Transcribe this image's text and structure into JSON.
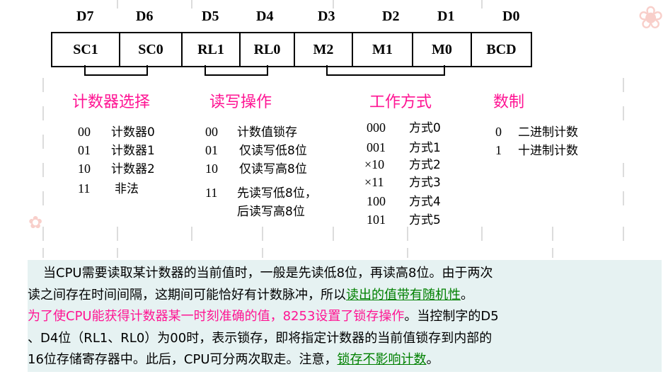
{
  "bits": [
    "D7",
    "D6",
    "D5",
    "D4",
    "D3",
    "D2",
    "D1",
    "D0"
  ],
  "register": [
    {
      "label": "SC1"
    },
    {
      "label": "SC0"
    },
    {
      "label": "RL1"
    },
    {
      "label": "RL0"
    },
    {
      "label": "M2"
    },
    {
      "label": "M1"
    },
    {
      "label": "M0"
    },
    {
      "label": "BCD"
    }
  ],
  "groups": {
    "sc": {
      "title": "计数器选择",
      "rows": [
        {
          "code": "00",
          "desc": "计数器0"
        },
        {
          "code": "01",
          "desc": "计数器1"
        },
        {
          "code": "10",
          "desc": "计数器2"
        },
        {
          "code": "11",
          "desc": "非法"
        }
      ]
    },
    "rl": {
      "title": "读写操作",
      "rows": [
        {
          "code": "00",
          "desc": "计数值锁存"
        },
        {
          "code": "01",
          "desc": "仅读写低8位"
        },
        {
          "code": "10",
          "desc": "仅读写高8位"
        },
        {
          "code": "11",
          "desc": "先读写低8位，"
        },
        {
          "code": "",
          "desc": "后读写高8位"
        }
      ]
    },
    "m": {
      "title": "工作方式",
      "rows": [
        {
          "code": "000",
          "desc": "方式0"
        },
        {
          "code": "001",
          "desc": "方式1"
        },
        {
          "code": "×10",
          "desc": "方式2"
        },
        {
          "code": "×11",
          "desc": "方式3"
        },
        {
          "code": "100",
          "desc": "方式4"
        },
        {
          "code": "101",
          "desc": "方式5"
        }
      ]
    },
    "bcd": {
      "title": "数制",
      "rows": [
        {
          "code": "0",
          "desc": "二进制计数"
        },
        {
          "code": "1",
          "desc": "十进制计数"
        }
      ]
    }
  },
  "paragraph": {
    "l1": "当CPU需要读取某计数器的当前值时，一般是先读低8位，再读高8位。由于两次",
    "l2a": "读之间存在时间间隔，这期间可能恰好有计数脉冲，所以",
    "l2b": "读出的值带有随机性",
    "l2c": "。",
    "l3a": "为了使CPU能获得计数器某一时刻准确的值，8253设置了锁存操作",
    "l3b": "。当控制字的D5",
    "l4": "、D4位（RL1、RL0）为00时，表示锁存，即将指定计数器的当前值锁存到内部的",
    "l5a": "16位存储寄存器中。此后，CPU可分两次取走。注意，",
    "l5b": "锁存不影响计数",
    "l5c": "。"
  }
}
